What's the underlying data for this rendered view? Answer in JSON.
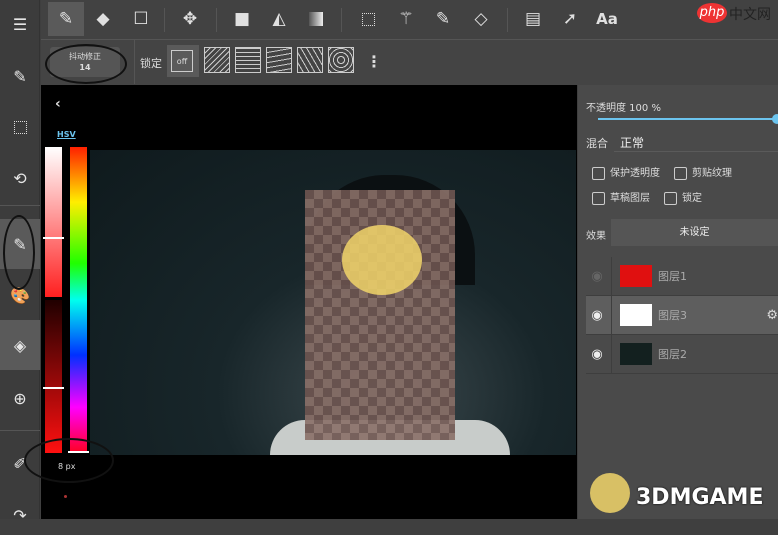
{
  "sidebar": {
    "items": [
      "menu-icon",
      "edit-layer-icon",
      "selection-icon",
      "rotate-icon",
      "pen-icon",
      "palette-icon",
      "layers-icon",
      "grid-icon",
      "eyedropper-icon",
      "redo-icon"
    ]
  },
  "toolbar": {
    "tools": [
      "pen",
      "eraser",
      "rectangle",
      "move",
      "fill-color",
      "bucket",
      "gradient",
      "select-rect",
      "magic-wand",
      "select-pen",
      "select-eraser",
      "panel-layout",
      "pointer",
      "text"
    ],
    "text_tool_label": "Aa"
  },
  "subbar": {
    "stabilizer_label": "抖动修正",
    "stabilizer_value": "14",
    "lock_label": "锁定",
    "lock_off": "off"
  },
  "color": {
    "mode_label": "HSV",
    "brush_size": "8 px"
  },
  "layer_panel": {
    "opacity_label": "不透明度 100 %",
    "opacity": 100,
    "blend_label": "混合",
    "blend_value": "正常",
    "checkboxes": [
      {
        "label": "保护透明度",
        "checked": false
      },
      {
        "label": "剪贴纹理",
        "checked": false
      },
      {
        "label": "草稿图层",
        "checked": false
      },
      {
        "label": "锁定",
        "checked": false
      }
    ],
    "effect_label": "效果",
    "effect_value": "未设定",
    "layers": [
      {
        "name": "图层1",
        "visible": false
      },
      {
        "name": "图层3",
        "visible": true,
        "selected": true
      },
      {
        "name": "图层2",
        "visible": true
      }
    ]
  },
  "watermarks": {
    "php": "php",
    "php_cn": "中文网",
    "game": "3DMGAME"
  },
  "colors": {
    "accent": "#6cc4ee",
    "selected_red": "#ff1010"
  }
}
